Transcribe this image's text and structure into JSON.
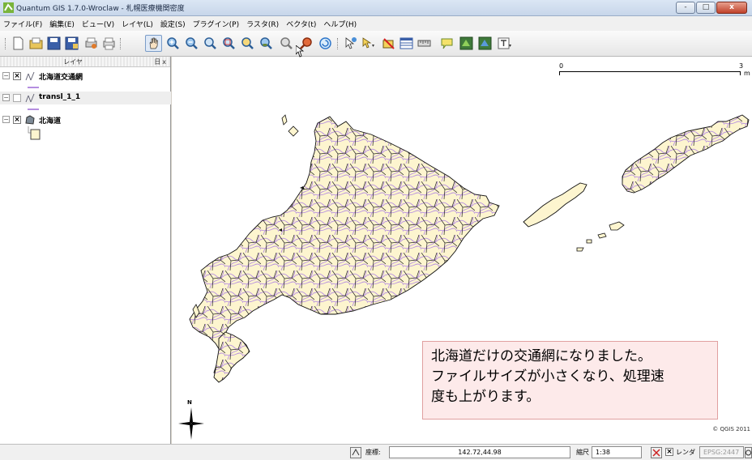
{
  "window": {
    "title": "Quantum GIS 1.7.0-Wroclaw - 札幌医療機関密度",
    "buttons": {
      "minimize": "-",
      "maximize": "□",
      "close": "x"
    }
  },
  "menu": [
    "ファイル(F)",
    "編集(E)",
    "ビュー(V)",
    "レイヤ(L)",
    "設定(S)",
    "プラグイン(P)",
    "ラスタ(R)",
    "ベクタ(t)",
    "ヘルプ(H)"
  ],
  "toolbar": {
    "tools": [
      "new-project",
      "open-project",
      "save-project",
      "save-as",
      "print-composer",
      "print",
      "pan",
      "zoom-in",
      "zoom-out",
      "zoom-full",
      "zoom-to-selection",
      "zoom-to-layer",
      "zoom-native",
      "zoom-last",
      "zoom-next",
      "refresh",
      "identify",
      "select",
      "deselect",
      "attribute-table",
      "measure",
      "map-tips",
      "new-bookmark",
      "show-bookmarks",
      "text-annotation"
    ]
  },
  "layers_panel": {
    "title": "レイヤ",
    "float_close": "日x",
    "layers": [
      {
        "name": "北海道交通網",
        "checked": true,
        "type": "line",
        "legend_color": "#b58ee0"
      },
      {
        "name": "transl_1_1",
        "checked": false,
        "type": "line",
        "legend_color": "#b58ee0"
      },
      {
        "name": "北海道",
        "checked": true,
        "type": "polygon",
        "legend_color": "#fdf5cf"
      }
    ]
  },
  "map": {
    "scale_bar": {
      "start": "0",
      "end": "3",
      "unit": "m"
    },
    "callout": {
      "lines": [
        "北海道だけの交通網になりました。",
        "ファイルサイズが小さくなり、処理速",
        "度も上がります。"
      ]
    },
    "north_label": "N",
    "copyright": "© QGIS 2011",
    "colors": {
      "land": "#fdf5cf",
      "roads": "#b58ee0",
      "borders": "#000000"
    }
  },
  "status": {
    "coord_label": "座標:",
    "coord_value": "142.72,44.98",
    "scale_label": "縮尺",
    "scale_value": "1:38",
    "render_label": "レンダ",
    "crs": "EPSG:2447"
  }
}
